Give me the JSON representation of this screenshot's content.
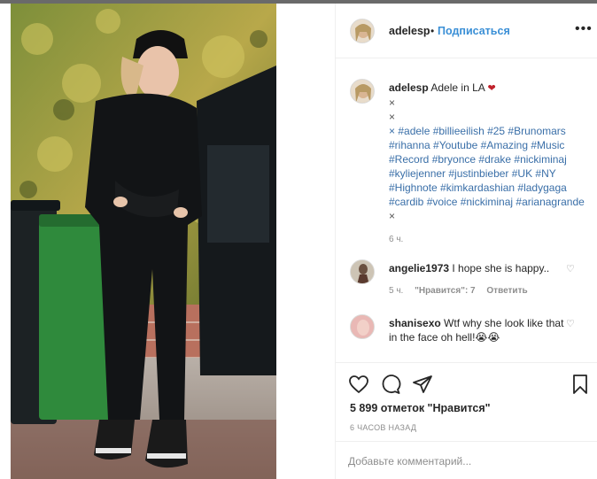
{
  "post": {
    "username": "adelesp",
    "follow_label": "Подписаться",
    "more_label": "•••"
  },
  "caption": {
    "username": "adelesp",
    "text": "Adele in LA",
    "heart": "❤",
    "x_marks": [
      "×",
      "×"
    ],
    "hashtags": "× #adele #billieeilish #25 #Brunomars #rihanna #Youtube #Amazing #Music #Record #bryonce #drake #nickiminaj #kyliejenner #justinbieber #UK #NY #Highnote #kimkardashian #ladygaga #cardib #voice #nickiminaj #arianagrande",
    "trailing_x": "×",
    "time": "6 ч."
  },
  "comments": [
    {
      "username": "angelie1973",
      "text": "I hope she is happy..",
      "time": "5 ч.",
      "likes": "\"Нравится\": 7",
      "reply": "Ответить"
    },
    {
      "username": "shanisexo",
      "text": "Wtf why she look like that in the face oh hell!😭😭"
    }
  ],
  "actions": {
    "likes_text": "5 899 отметок \"Нравится\"",
    "posted": "6 ЧАСОВ НАЗАД",
    "comment_placeholder": "Добавьте комментарий..."
  },
  "colors": {
    "follow": "#3a8fd6",
    "hashtag": "#3a6fa8",
    "heart": "#c0202a"
  }
}
